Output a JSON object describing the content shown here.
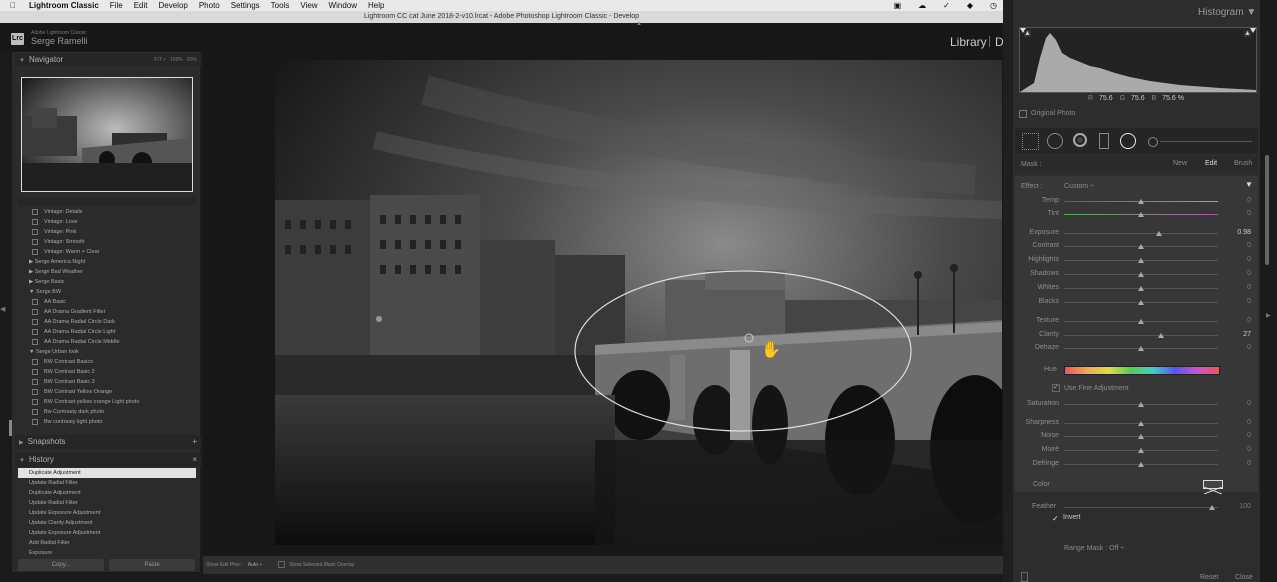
{
  "menubar": {
    "app": "Lightroom Classic",
    "items": [
      "File",
      "Edit",
      "Develop",
      "Photo",
      "Settings",
      "Tools",
      "View",
      "Window",
      "Help"
    ]
  },
  "window_title": "Lightroom CC cat June 2018-2-v10.lrcat - Adobe Photoshop Lightroom Classic - Develop",
  "identity": {
    "logo": "Lrc",
    "product": "Adobe Lightroom Classic",
    "user": "Serge Ramelli"
  },
  "modules": {
    "library": "Library",
    "develop_initial": "D"
  },
  "navigator": {
    "title": "Navigator",
    "zoom_options": [
      "FIT ÷",
      "100%",
      "50%"
    ]
  },
  "presets": [
    {
      "type": "item",
      "label": "Vintage: Details"
    },
    {
      "type": "item",
      "label": "Vintage: Love"
    },
    {
      "type": "item",
      "label": "Vintage: Pink"
    },
    {
      "type": "item",
      "label": "Vintage: Smooth"
    },
    {
      "type": "item",
      "label": "Vintage: Warm + Clear"
    },
    {
      "type": "folder",
      "label": "▶ Serge America Night"
    },
    {
      "type": "folder",
      "label": "▶ Serge Bad Weather"
    },
    {
      "type": "folder",
      "label": "▶ Serge Basic"
    },
    {
      "type": "folder",
      "label": "▼ Serge BW"
    },
    {
      "type": "item",
      "label": "AA Basic"
    },
    {
      "type": "item",
      "label": "AA Drama Gradient Filter"
    },
    {
      "type": "item",
      "label": "AA Drama Radial Circle Dark"
    },
    {
      "type": "item",
      "label": "AA Drama Radial Circle Light"
    },
    {
      "type": "item",
      "label": "AA Drama Radial Circle Middle"
    },
    {
      "type": "folder",
      "label": "▼ Serge Urban look"
    },
    {
      "type": "item",
      "label": "BW  Contrast Basics"
    },
    {
      "type": "item",
      "label": "BW Contrast Basic 2"
    },
    {
      "type": "item",
      "label": "BW Contrast Basic 3"
    },
    {
      "type": "item",
      "label": "BW Contrast Yellow Orange"
    },
    {
      "type": "item",
      "label": "BW Contrast yellow orange Light photo"
    },
    {
      "type": "item",
      "label": "Bw Contrasty dark photo"
    },
    {
      "type": "item",
      "label": "Bw contrasty light photo"
    }
  ],
  "snapshots": {
    "title": "Snapshots",
    "add": "+"
  },
  "history": {
    "title": "History",
    "clear": "×",
    "items": [
      "Duplicate Adjustment",
      "Update Radial Filter",
      "Duplicate Adjustment",
      "Update Radial Filter",
      "Update Exposure Adjustment",
      "Update Clarity Adjustment",
      "Update Exposure Adjustment",
      "Add Radial Filter",
      "Exposure"
    ]
  },
  "buttons": {
    "copy": "Copy...",
    "paste": "Paste"
  },
  "toolbar": {
    "show_pins_label": "Show Edit Pins :",
    "show_pins_value": "Auto ÷",
    "overlay_label": "Show Selected Mask Overlay"
  },
  "histogram": {
    "title": "Histogram ▼",
    "r_label": "R",
    "r": "75.6",
    "g_label": "G",
    "g": "75.6",
    "b_label": "B",
    "b": "75.6 %",
    "original_photo": "Original Photo"
  },
  "mask": {
    "label": "Mask :",
    "new": "New",
    "edit": "Edit",
    "brush": "Brush"
  },
  "effect": {
    "label": "Effect :",
    "value": "Custom ÷"
  },
  "sliders": [
    {
      "label": "Temp",
      "value": "0",
      "pos": 0.5
    },
    {
      "label": "Tint",
      "value": "0",
      "pos": 0.5
    },
    {
      "label": "Exposure",
      "value": "0.98",
      "pos": 0.62
    },
    {
      "label": "Contrast",
      "value": "0",
      "pos": 0.5
    },
    {
      "label": "Highlights",
      "value": "0",
      "pos": 0.5
    },
    {
      "label": "Shadows",
      "value": "0",
      "pos": 0.5
    },
    {
      "label": "Whites",
      "value": "0",
      "pos": 0.5
    },
    {
      "label": "Blacks",
      "value": "0",
      "pos": 0.5
    },
    {
      "label": "Texture",
      "value": "0",
      "pos": 0.5
    },
    {
      "label": "Clarity",
      "value": "27",
      "pos": 0.63
    },
    {
      "label": "Dehaze",
      "value": "0",
      "pos": 0.5
    },
    {
      "label": "Saturation",
      "value": "0",
      "pos": 0.5
    },
    {
      "label": "Sharpness",
      "value": "0",
      "pos": 0.5
    },
    {
      "label": "Noise",
      "value": "0",
      "pos": 0.5
    },
    {
      "label": "Moiré",
      "value": "0",
      "pos": 0.5
    },
    {
      "label": "Defringe",
      "value": "0",
      "pos": 0.5
    }
  ],
  "hue": {
    "label": "Hue",
    "fine": "Use Fine Adjustment"
  },
  "color": {
    "label": "Color"
  },
  "feather": {
    "label": "Feather",
    "value": "100",
    "pos": 0.96
  },
  "invert": {
    "label": "Invert",
    "check": "✓"
  },
  "range_mask": {
    "label": "Range Mask : Off ÷"
  },
  "footer": {
    "reset": "Reset",
    "close": "Close"
  }
}
